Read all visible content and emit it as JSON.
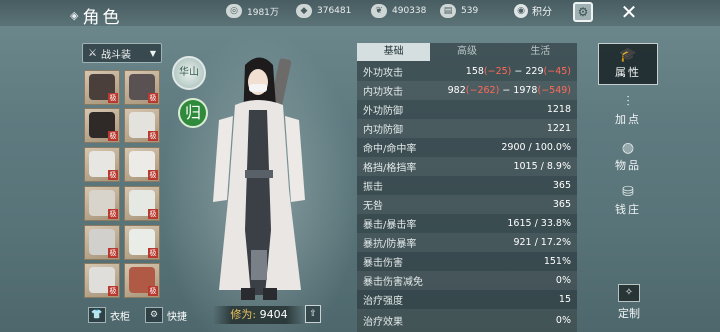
{
  "header": {
    "title": "角色",
    "currencies": [
      {
        "icon": "coin-icon",
        "value": "1981万"
      },
      {
        "icon": "silver-icon",
        "value": "376481"
      },
      {
        "icon": "jade-icon",
        "value": "490338"
      },
      {
        "icon": "ticket-icon",
        "value": "539"
      }
    ],
    "points_label": "积分"
  },
  "equipment": {
    "outfit_label": "战斗装",
    "badge": "极",
    "slots": [
      {
        "icon": "bracer-icon"
      },
      {
        "icon": "shoulder-icon"
      },
      {
        "icon": "head-icon"
      },
      {
        "icon": "necklace-icon"
      },
      {
        "icon": "chest-icon"
      },
      {
        "icon": "glove-icon"
      },
      {
        "icon": "belt-icon"
      },
      {
        "icon": "bracelet-icon"
      },
      {
        "icon": "pants-icon"
      },
      {
        "icon": "ring-icon"
      },
      {
        "icon": "boots-icon"
      },
      {
        "icon": "pendant-icon"
      }
    ],
    "wardrobe_label": "衣柜",
    "quick_label": "快捷"
  },
  "character": {
    "school_seal": "华山",
    "gui_label": "归",
    "cultivation_label": "修为",
    "cultivation_value": "9404"
  },
  "stats": {
    "tabs": [
      "基础",
      "高级",
      "生活"
    ],
    "active_tab": 0,
    "rows": [
      {
        "label": "外功攻击",
        "value": "158",
        "parts": [
          "158",
          "(−25)",
          " − 229",
          "(−45)"
        ]
      },
      {
        "label": "内功攻击",
        "parts": [
          "982",
          "(−262)",
          " − 1978",
          "(−549)"
        ]
      },
      {
        "label": "外功防御",
        "value": "1218"
      },
      {
        "label": "内功防御",
        "value": "1221"
      },
      {
        "label": "命中/命中率",
        "value": "2900 / 100.0%"
      },
      {
        "label": "格挡/格挡率",
        "value": "1015 / 8.9%"
      },
      {
        "label": "振击",
        "value": "365"
      },
      {
        "label": "无咎",
        "value": "365"
      },
      {
        "label": "暴击/暴击率",
        "value": "1615 / 33.8%"
      },
      {
        "label": "暴抗/防暴率",
        "value": "921 / 17.2%"
      },
      {
        "label": "暴击伤害",
        "value": "151%"
      },
      {
        "label": "暴击伤害减免",
        "value": "0%"
      },
      {
        "label": "治疗强度",
        "value": "15"
      },
      {
        "label": "治疗效果",
        "value": "0%"
      }
    ]
  },
  "menu": {
    "items": [
      {
        "label": "属性",
        "icon": "attribute-icon"
      },
      {
        "label": "加点",
        "icon": "sliders-icon"
      },
      {
        "label": "物品",
        "icon": "bag-icon"
      },
      {
        "label": "钱庄",
        "icon": "bank-icon"
      }
    ],
    "active": 0,
    "custom_label": "定制"
  }
}
